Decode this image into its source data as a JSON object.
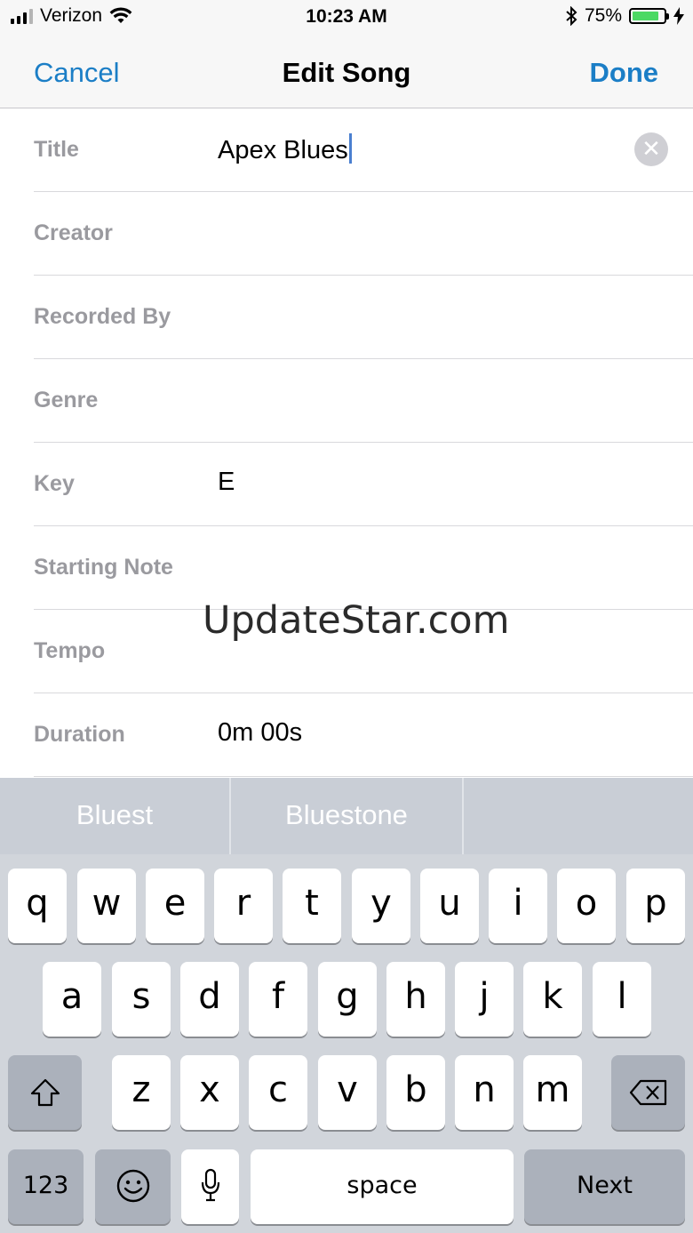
{
  "status_bar": {
    "carrier": "Verizon",
    "time": "10:23 AM",
    "battery_percent": "75%",
    "battery_level": 0.75,
    "icons": [
      "signal-icon",
      "wifi-icon",
      "bluetooth-icon",
      "battery-icon",
      "charging-bolt-icon"
    ]
  },
  "nav": {
    "cancel_label": "Cancel",
    "title": "Edit Song",
    "done_label": "Done"
  },
  "form": {
    "rows": [
      {
        "label": "Title",
        "value": "Apex Blues"
      },
      {
        "label": "Creator",
        "value": ""
      },
      {
        "label": "Recorded By",
        "value": ""
      },
      {
        "label": "Genre",
        "value": ""
      },
      {
        "label": "Key",
        "value": "E"
      },
      {
        "label": "Starting Note",
        "value": ""
      },
      {
        "label": "Tempo",
        "value": ""
      },
      {
        "label": "Duration",
        "value": "0m 00s"
      }
    ]
  },
  "watermark": "UpdateStar.com",
  "keyboard": {
    "suggestions": [
      "Bluest",
      "Bluestone",
      ""
    ],
    "row1": [
      "q",
      "w",
      "e",
      "r",
      "t",
      "y",
      "u",
      "i",
      "o",
      "p"
    ],
    "row2": [
      "a",
      "s",
      "d",
      "f",
      "g",
      "h",
      "j",
      "k",
      "l"
    ],
    "row3": [
      "z",
      "x",
      "c",
      "v",
      "b",
      "n",
      "m"
    ],
    "numbers_label": "123",
    "space_label": "space",
    "next_label": "Next"
  },
  "colors": {
    "accent": "#1b7ec6",
    "label_gray": "#9a9a9f",
    "battery_green": "#4cd964",
    "keyboard_bg": "#d1d5db"
  }
}
